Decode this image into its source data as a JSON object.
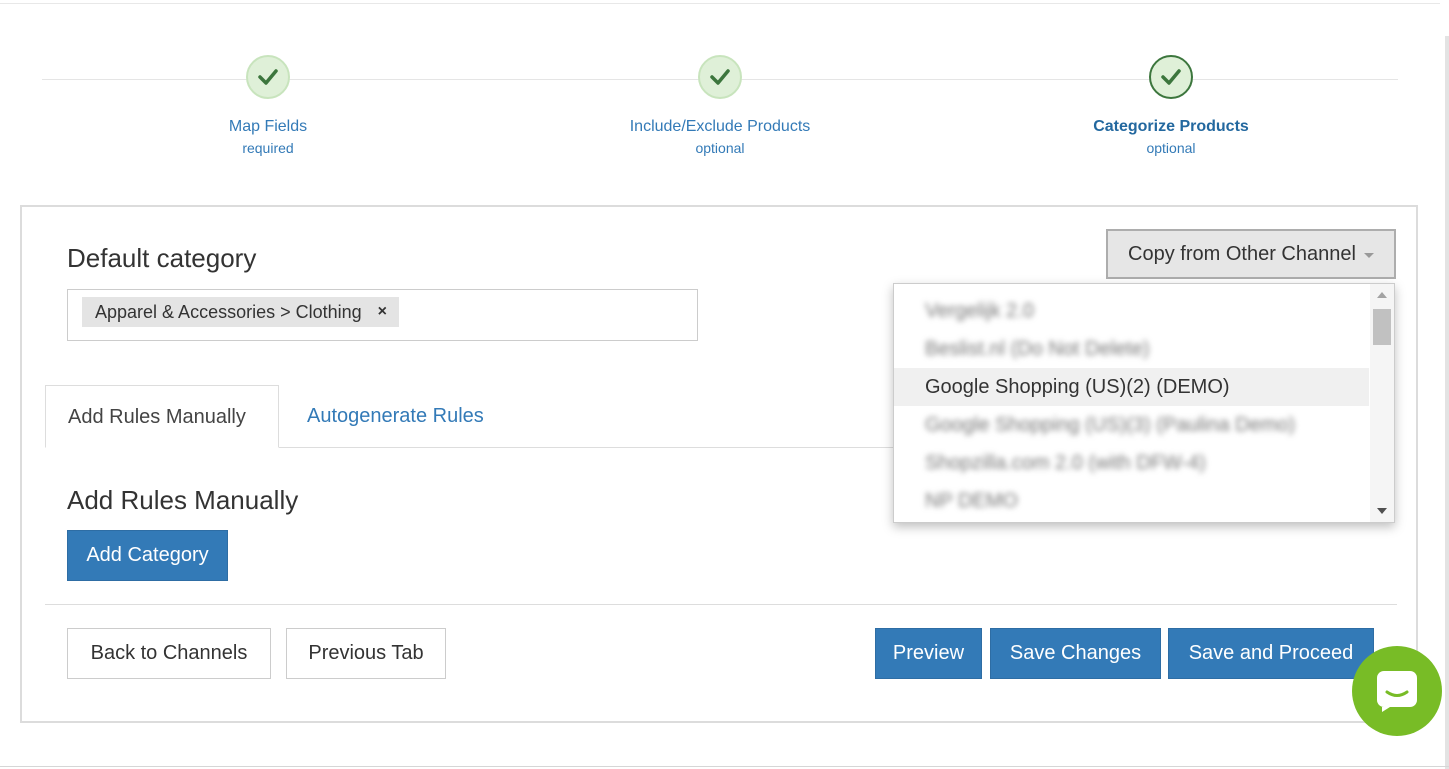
{
  "wizard": {
    "steps": [
      {
        "label": "Map Fields",
        "sub": "required",
        "state": "complete"
      },
      {
        "label": "Include/Exclude Products",
        "sub": "optional",
        "state": "complete"
      },
      {
        "label": "Categorize Products",
        "sub": "optional",
        "state": "active"
      }
    ]
  },
  "default_category": {
    "title": "Default category",
    "tag": "Apparel & Accessories > Clothing",
    "remove_symbol": "×"
  },
  "copy_channel": {
    "label": "Copy from Other Channel",
    "options": [
      {
        "label": "Vergelijk 2.0",
        "blurred": true
      },
      {
        "label": "Beslist.nl (Do Not Delete)",
        "blurred": true
      },
      {
        "label": "Google Shopping (US)(2) (DEMO)",
        "blurred": false,
        "highlighted": true
      },
      {
        "label": "Google Shopping (US)(3) (Paulina Demo)",
        "blurred": true
      },
      {
        "label": "Shopzilla.com 2.0 (with DFW-4)",
        "blurred": true
      },
      {
        "label": "NP DEMO",
        "blurred": true
      }
    ]
  },
  "tabs": {
    "manual": "Add Rules Manually",
    "auto": "Autogenerate Rules"
  },
  "rules": {
    "title": "Add Rules Manually",
    "add_category": "Add Category"
  },
  "footer": {
    "back": "Back to Channels",
    "previous": "Previous Tab",
    "preview": "Preview",
    "save": "Save Changes",
    "proceed": "Save and Proceed"
  },
  "colors": {
    "primary": "#337ab7",
    "success_bg": "#dff0d8",
    "success_dark": "#3c763d",
    "chat": "#78bc26"
  }
}
